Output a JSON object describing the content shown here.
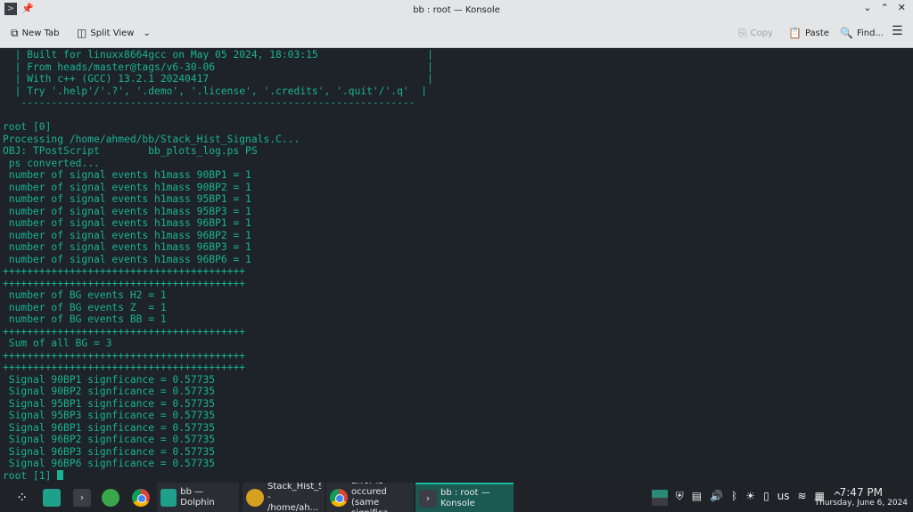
{
  "window": {
    "title": "bb : root — Konsole",
    "controls": [
      "⌄",
      "⌃",
      "✕"
    ]
  },
  "toolbar": {
    "new_tab": "New Tab",
    "split_view": "Split View",
    "copy": "Copy",
    "paste": "Paste",
    "find": "Find..."
  },
  "terminal": {
    "lines": [
      "  | Built for linuxx8664gcc on May 05 2024, 18:03:15                  |",
      "  | From heads/master@tags/v6-30-06                                   |",
      "  | With c++ (GCC) 13.2.1 20240417                                    |",
      "  | Try '.help'/'.?', '.demo', '.license', '.credits', '.quit'/'.q'  |",
      "   -----------------------------------------------------------------",
      "",
      "root [0]",
      "Processing /home/ahmed/bb/Stack_Hist_Signals.C...",
      "OBJ: TPostScript        bb_plots_log.ps PS",
      " ps converted...",
      " number of signal events h1mass 90BP1 = 1",
      " number of signal events h1mass 90BP2 = 1",
      " number of signal events h1mass 95BP1 = 1",
      " number of signal events h1mass 95BP3 = 1",
      " number of signal events h1mass 96BP1 = 1",
      " number of signal events h1mass 96BP2 = 1",
      " number of signal events h1mass 96BP3 = 1",
      " number of signal events h1mass 96BP6 = 1",
      "++++++++++++++++++++++++++++++++++++++++",
      "++++++++++++++++++++++++++++++++++++++++",
      " number of BG events H2 = 1",
      " number of BG events Z  = 1",
      " number of BG events BB = 1",
      "++++++++++++++++++++++++++++++++++++++++",
      " Sum of all BG = 3",
      "++++++++++++++++++++++++++++++++++++++++",
      "++++++++++++++++++++++++++++++++++++++++",
      " Signal 90BP1 signficance = 0.57735",
      " Signal 90BP2 signficance = 0.57735",
      " Signal 95BP1 signficance = 0.57735",
      " Signal 95BP3 signficance = 0.57735",
      " Signal 96BP1 signficance = 0.57735",
      " Signal 96BP2 signficance = 0.57735",
      " Signal 96BP3 signficance = 0.57735",
      " Signal 96BP6 signficance = 0.57735"
    ],
    "prompt": "root [1] "
  },
  "taskbar": {
    "tasks": [
      {
        "label": "bb — Dolphin"
      },
      {
        "label": "Stack_Hist_Signals.C - /home/ah..."
      },
      {
        "label": "Error is occured (same significa..."
      },
      {
        "label": "bb : root — Konsole"
      }
    ],
    "keyboard_layout": "us",
    "time": "7:47 PM",
    "date": "Thursday, June 6, 2024"
  },
  "colors": {
    "terminal_text": "#19b394",
    "terminal_bg": "#1e2229",
    "accent": "#1abc9c"
  }
}
